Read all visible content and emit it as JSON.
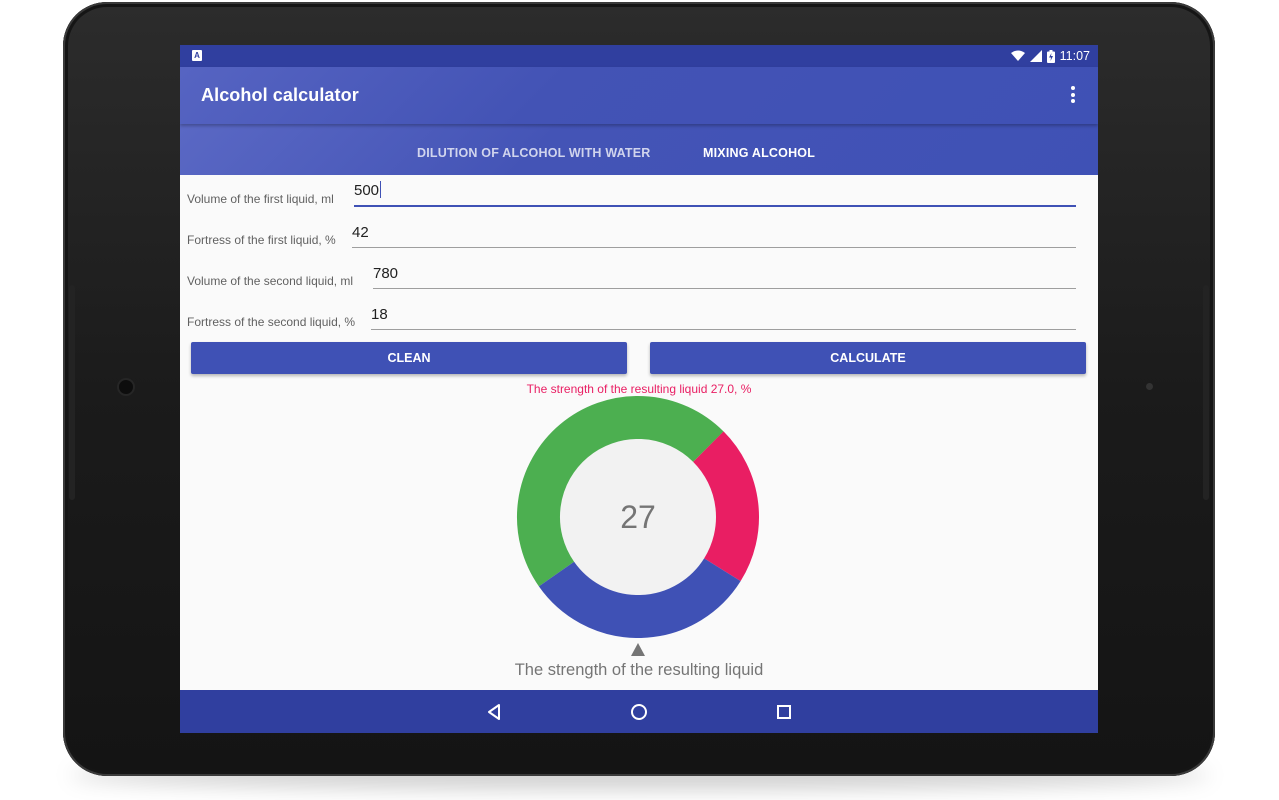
{
  "status_bar": {
    "time": "11:07"
  },
  "app_bar": {
    "title": "Alcohol calculator",
    "overflow_icon": "more-vert-icon"
  },
  "tabs": [
    {
      "label": "DILUTION OF ALCOHOL WITH WATER",
      "selected": false
    },
    {
      "label": "MIXING ALCOHOL",
      "selected": true
    }
  ],
  "form": {
    "fields": [
      {
        "label": "Volume of the first liquid, ml",
        "value": "500"
      },
      {
        "label": "Fortress of the first liquid, %",
        "value": "42"
      },
      {
        "label": "Volume of the second liquid, ml",
        "value": "780"
      },
      {
        "label": "Fortress of the second liquid, %",
        "value": "18"
      }
    ]
  },
  "buttons": {
    "clean": "CLEAN",
    "calculate": "CALCULATE"
  },
  "result": {
    "text": "The strength of the resulting liquid 27.0, %",
    "gauge_value": "27",
    "gauge_caption": "The strength of the resulting liquid"
  },
  "colors": {
    "primary": "#3f51b5",
    "primary_dark": "#303f9f",
    "accent": "#e91e63",
    "gauge_green": "#4caf50",
    "gauge_pink": "#e91e63",
    "gauge_blue": "#3f51b5"
  },
  "nav_bar": {
    "icons": [
      "back-icon",
      "home-icon",
      "recents-icon"
    ]
  }
}
